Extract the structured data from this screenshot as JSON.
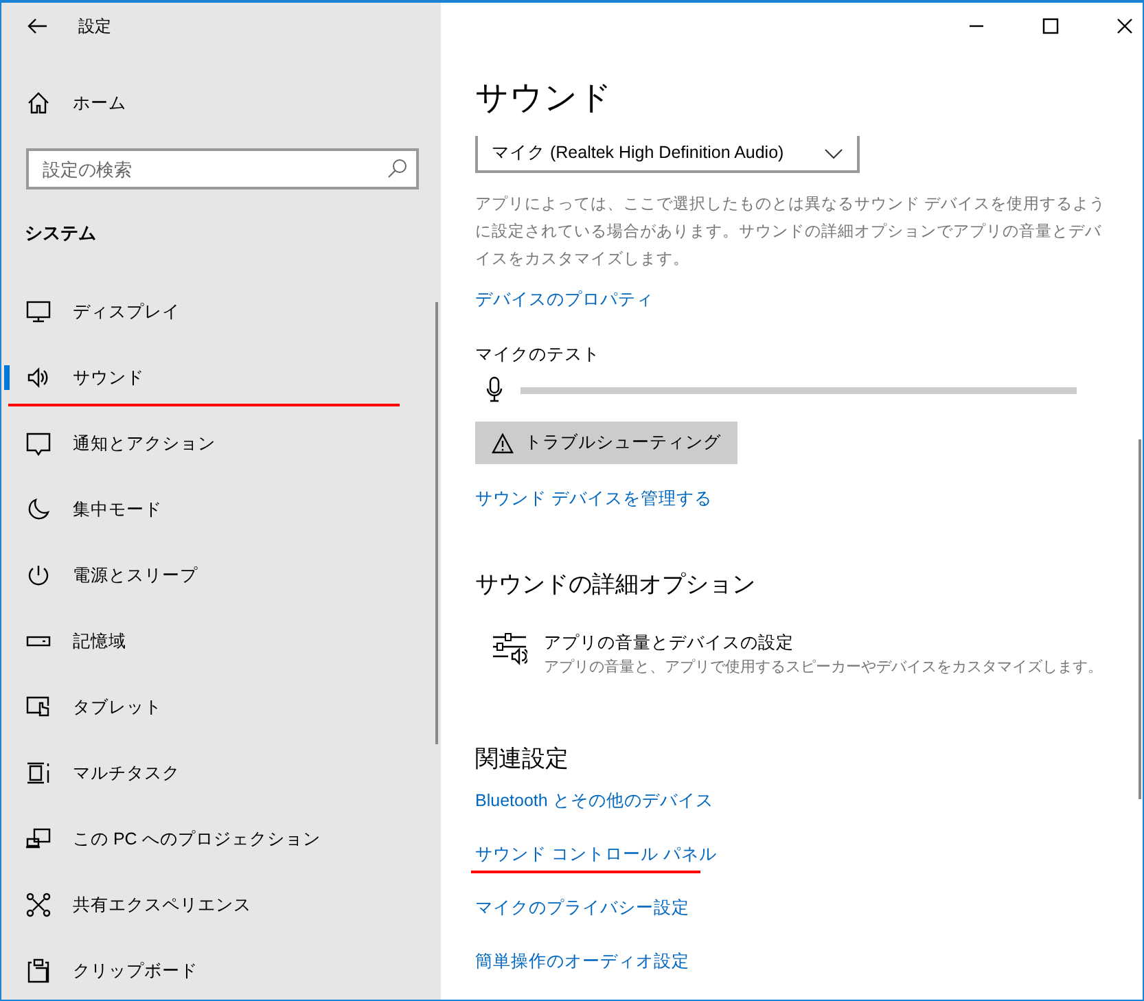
{
  "window": {
    "title": "設定"
  },
  "sidebar": {
    "home": "ホーム",
    "search": {
      "placeholder": "設定の検索"
    },
    "section": "システム",
    "items": [
      {
        "label": "ディスプレイ",
        "selected": false,
        "highlighted": false
      },
      {
        "label": "サウンド",
        "selected": true,
        "highlighted": true
      },
      {
        "label": "通知とアクション",
        "selected": false,
        "highlighted": false
      },
      {
        "label": "集中モード",
        "selected": false,
        "highlighted": false
      },
      {
        "label": "電源とスリープ",
        "selected": false,
        "highlighted": false
      },
      {
        "label": "記憶域",
        "selected": false,
        "highlighted": false
      },
      {
        "label": "タブレット",
        "selected": false,
        "highlighted": false
      },
      {
        "label": "マルチタスク",
        "selected": false,
        "highlighted": false
      },
      {
        "label": "この PC へのプロジェクション",
        "selected": false,
        "highlighted": false
      },
      {
        "label": "共有エクスペリエンス",
        "selected": false,
        "highlighted": false
      },
      {
        "label": "クリップボード",
        "selected": false,
        "highlighted": false
      }
    ]
  },
  "content": {
    "title": "サウンド",
    "input_device": {
      "value": "マイク (Realtek High Definition Audio)"
    },
    "description": "アプリによっては、ここで選択したものとは異なるサウンド デバイスを使用するように設定されている場合があります。サウンドの詳細オプションでアプリの音量とデバイスをカスタマイズします。",
    "device_properties_link": "デバイスのプロパティ",
    "mic_test": {
      "label": "マイクのテスト",
      "level": 0
    },
    "troubleshoot_button": "トラブルシューティング",
    "manage_devices_link": "サウンド デバイスを管理する",
    "advanced": {
      "heading": "サウンドの詳細オプション",
      "item": {
        "title": "アプリの音量とデバイスの設定",
        "subtitle": "アプリの音量と、アプリで使用するスピーカーやデバイスをカスタマイズします。"
      }
    },
    "related": {
      "heading": "関連設定",
      "links": [
        {
          "label": "Bluetooth とその他のデバイス",
          "highlighted": false
        },
        {
          "label": "サウンド コントロール パネル",
          "highlighted": true
        },
        {
          "label": "マイクのプライバシー設定",
          "highlighted": false
        },
        {
          "label": "簡単操作のオーディオ設定",
          "highlighted": false
        }
      ]
    }
  }
}
